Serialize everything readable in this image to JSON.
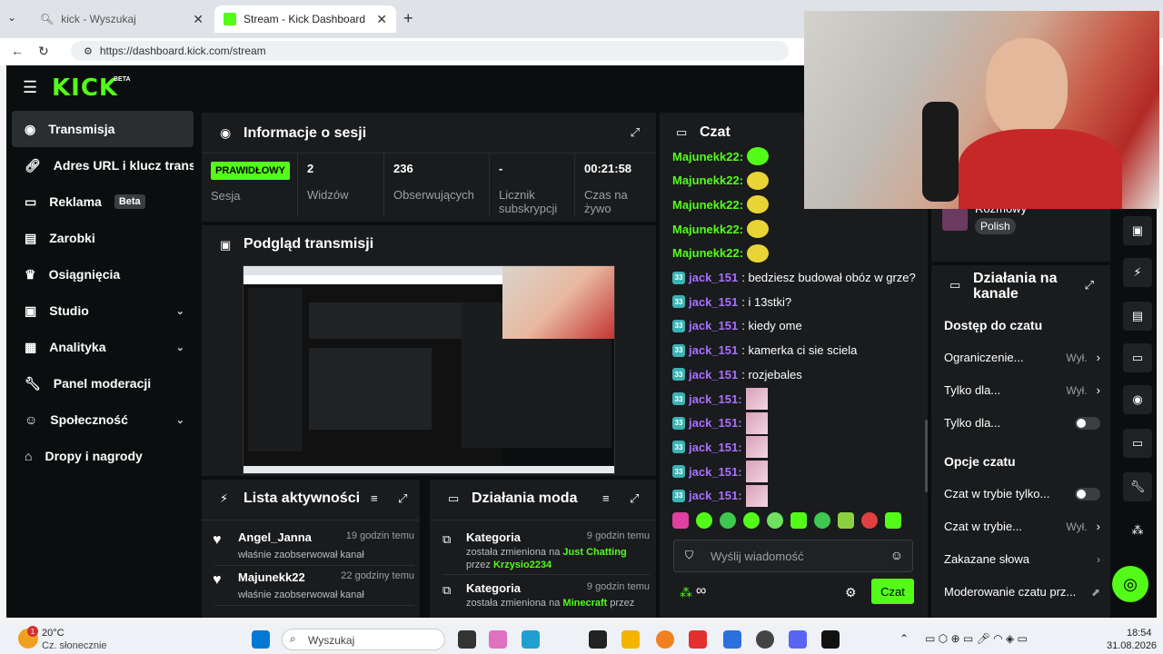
{
  "browser": {
    "tabs": [
      {
        "title": "kick - Wyszukaj"
      },
      {
        "title": "Stream - Kick Dashboard"
      }
    ],
    "url": "https://dashboard.kick.com/stream"
  },
  "brand": {
    "logo": "KICK",
    "tag": "BETA",
    "accent": "#53fc18"
  },
  "sidebar": {
    "items": [
      {
        "label": "Transmisja",
        "icon": "play-circle-icon"
      },
      {
        "label": "Adres URL i klucz transmisji",
        "icon": "link-icon"
      },
      {
        "label": "Reklama",
        "badge": "Beta",
        "icon": "ad-icon"
      },
      {
        "label": "Zarobki",
        "icon": "earnings-icon"
      },
      {
        "label": "Osiągnięcia",
        "icon": "trophy-icon"
      },
      {
        "label": "Studio",
        "icon": "studio-icon"
      },
      {
        "label": "Analityka",
        "icon": "chart-icon"
      },
      {
        "label": "Panel moderacji",
        "icon": "wrench-icon"
      },
      {
        "label": "Społeczność",
        "icon": "community-icon"
      },
      {
        "label": "Dropy i nagrody",
        "icon": "gift-icon"
      }
    ]
  },
  "session": {
    "title": "Informacje o sesji",
    "status": "PRAWIDŁOWY",
    "status_label": "Sesja",
    "stats": [
      {
        "value": "2",
        "label": "Widzów"
      },
      {
        "value": "236",
        "label": "Obserwujących"
      },
      {
        "value": "-",
        "label": "Licznik subskrypcji"
      },
      {
        "value": "00:21:58",
        "label": "Czas na żywo"
      }
    ]
  },
  "preview": {
    "title": "Podgląd transmisji"
  },
  "activity": {
    "title": "Lista aktywności",
    "items": [
      {
        "name": "Angel_Janna",
        "time": "19 godzin temu",
        "text": "właśnie zaobserwował kanał"
      },
      {
        "name": "Majunekk22",
        "time": "22 godziny temu",
        "text": "właśnie zaobserwował kanał"
      }
    ]
  },
  "modactions": {
    "title": "Działania moda",
    "items": [
      {
        "name": "Kategoria",
        "time": "9 godzin temu",
        "text": "została zmieniona na",
        "target": "Just Chatting",
        "by_label": "przez",
        "by": "Krzysio2234"
      },
      {
        "name": "Kategoria",
        "time": "9 godzin temu",
        "text": "została zmieniona na",
        "target": "Minecraft",
        "by_label": "przez",
        "by": ""
      }
    ]
  },
  "chat": {
    "title": "Czat",
    "messages": [
      {
        "user": "Majunekk22:",
        "color": "#53fc18",
        "text": "",
        "emote": "green"
      },
      {
        "user": "Majunekk22:",
        "color": "#53fc18",
        "text": "",
        "emote": "yellow"
      },
      {
        "user": "Majunekk22:",
        "color": "#53fc18",
        "text": "",
        "emote": "yellow"
      },
      {
        "user": "Majunekk22:",
        "color": "#53fc18",
        "text": "",
        "emote": "yellow"
      },
      {
        "user": "Majunekk22:",
        "color": "#53fc18",
        "text": "",
        "emote": "yellow"
      },
      {
        "user": "jack_151",
        "color": "#a970ff",
        "text": ": bedziesz budował obóz w grze?",
        "badge": "33"
      },
      {
        "user": "jack_151",
        "color": "#a970ff",
        "text": ": i 13stki?",
        "badge": "33"
      },
      {
        "user": "jack_151",
        "color": "#a970ff",
        "text": ": kiedy ome",
        "badge": "33"
      },
      {
        "user": "jack_151",
        "color": "#a970ff",
        "text": ": kamerka ci sie sciela",
        "badge": "33"
      },
      {
        "user": "jack_151",
        "color": "#a970ff",
        "text": ": rozjebales",
        "badge": "33"
      },
      {
        "user": "jack_151:",
        "color": "#a970ff",
        "text": "",
        "badge": "33",
        "emote": "pink"
      },
      {
        "user": "jack_151:",
        "color": "#a970ff",
        "text": "",
        "badge": "33",
        "emote": "pink"
      },
      {
        "user": "jack_151:",
        "color": "#a970ff",
        "text": "",
        "badge": "33",
        "emote": "pink"
      },
      {
        "user": "jack_151:",
        "color": "#a970ff",
        "text": "",
        "badge": "33",
        "emote": "pink"
      },
      {
        "user": "jack_151:",
        "color": "#a970ff",
        "text": "",
        "badge": "33",
        "emote": "pink"
      }
    ],
    "input_placeholder": "Wyślij wiadomość",
    "send_label": "Czat",
    "infinity": "∞"
  },
  "stream_info": {
    "name": "Rozmowy",
    "lang": "Polish"
  },
  "channel_actions": {
    "title": "Działania na kanale",
    "section1": "Dostęp do czatu",
    "section2": "Opcje czatu",
    "rows": [
      {
        "label": "Ograniczenie...",
        "value": "Wył."
      },
      {
        "label": "Tylko dla...",
        "value": "Wył."
      },
      {
        "label": "Tylko dla...",
        "toggle": true
      },
      {
        "label": "Czat w trybie tylko...",
        "toggle": true
      },
      {
        "label": "Czat w trybie...",
        "value": "Wył."
      },
      {
        "label": "Zakazane słowa"
      },
      {
        "label": "Moderowanie czatu prz..."
      }
    ]
  },
  "taskbar": {
    "weather_temp": "20°C",
    "weather_desc": "Cz. słonecznie",
    "weather_badge": "1",
    "search": "Wyszukaj",
    "time": "18:54",
    "date": "31.08.2026"
  }
}
